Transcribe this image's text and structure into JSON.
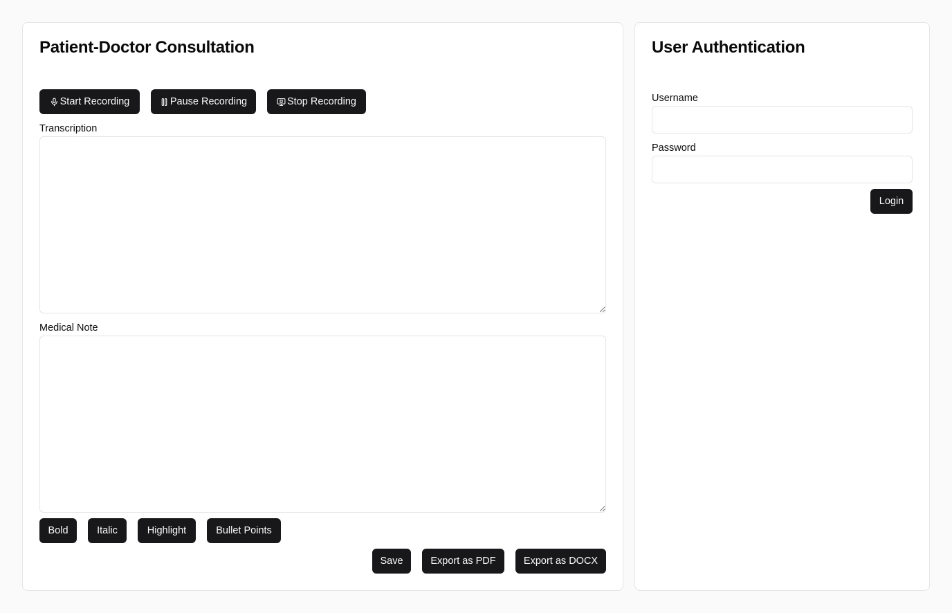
{
  "consultation": {
    "title": "Patient-Doctor Consultation",
    "recording_buttons": {
      "start": "Start Recording",
      "pause": "Pause Recording",
      "stop": "Stop Recording"
    },
    "transcription": {
      "label": "Transcription",
      "value": "",
      "placeholder": ""
    },
    "medical_note": {
      "label": "Medical Note",
      "value": "",
      "placeholder": ""
    },
    "format_buttons": {
      "bold": "Bold",
      "italic": "Italic",
      "highlight": "Highlight",
      "bullets": "Bullet Points"
    },
    "action_buttons": {
      "save": "Save",
      "export_pdf": "Export as PDF",
      "export_docx": "Export as DOCX"
    }
  },
  "auth": {
    "title": "User Authentication",
    "username": {
      "label": "Username",
      "value": "",
      "placeholder": ""
    },
    "password": {
      "label": "Password",
      "value": "",
      "placeholder": ""
    },
    "login": "Login"
  },
  "icons": {
    "start": "mic-icon",
    "pause": "pause-icon",
    "stop": "screen-stop-icon"
  },
  "colors": {
    "background": "#fafafa",
    "card": "#ffffff",
    "button": "#18181b",
    "button_text": "#fafafa",
    "border": "#e5e5e5"
  }
}
